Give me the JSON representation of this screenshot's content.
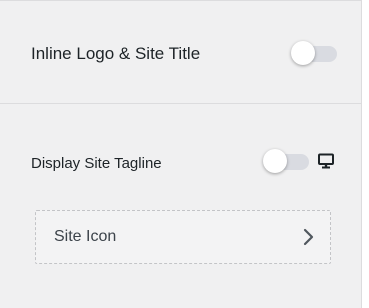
{
  "settings": {
    "inline_logo": {
      "label": "Inline Logo & Site Title",
      "enabled": false
    },
    "tagline": {
      "label": "Display Site Tagline",
      "enabled": false,
      "device_icon": "desktop-icon"
    },
    "site_icon": {
      "label": "Site Icon",
      "icon": "chevron-right-icon"
    }
  },
  "colors": {
    "panel_background": "#f0f0f1",
    "toggle_track_off": "#d9dbe1",
    "toggle_knob": "#ffffff",
    "divider": "#dcdcde"
  }
}
